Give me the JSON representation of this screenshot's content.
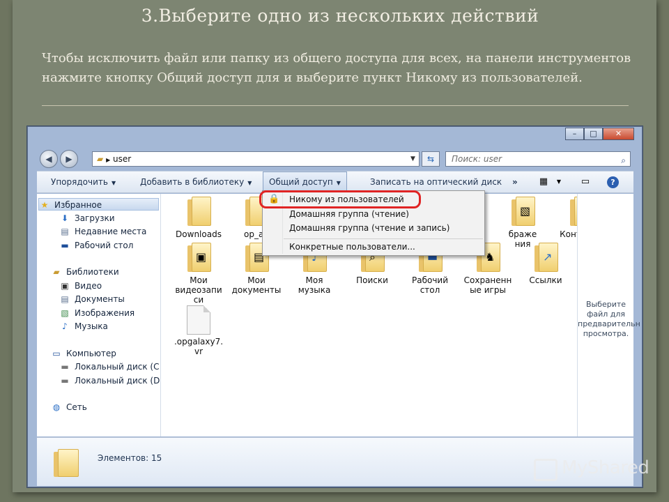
{
  "slide": {
    "title": "3.Выберите одно из нескольких действий",
    "text": "Чтобы исключить файл или папку из общего доступа для всех, на панели инструментов нажмите кнопку Общий доступ для и выберите пункт Никому из пользователей."
  },
  "window": {
    "address": "user",
    "search_placeholder": "Поиск: user",
    "controls": {
      "minimize": "–",
      "maximize": "□",
      "close": "✕"
    }
  },
  "toolbar": {
    "organize": "Упорядочить",
    "add_library": "Добавить в библиотеку",
    "share": "Общий доступ",
    "burn": "Записать на оптический диск",
    "more": "»"
  },
  "nav": {
    "favorites": "Избранное",
    "downloads": "Загрузки",
    "recent": "Недавние места",
    "desktop": "Рабочий стол",
    "libraries": "Библиотеки",
    "video": "Видео",
    "documents": "Документы",
    "images": "Изображения",
    "music": "Музыка",
    "computer": "Компьютер",
    "disk_c": "Локальный диск (C",
    "disk_d": "Локальный диск (D",
    "network": "Сеть"
  },
  "folders": {
    "downloads": "Downloads",
    "op_ad": "op_ad",
    "images_partial": "браже\nния",
    "contacts": "Контакты",
    "my_videos": "Мои\nвидеозапи\nси",
    "my_documents": "Мои\nдокументы",
    "my_music": "Моя\nмузыка",
    "searches": "Поиски",
    "desktop": "Рабочий\nстол",
    "saved_games": "Сохраненн\nые игры",
    "links": "Ссылки",
    "file": ".opgalaxy7.\nvr"
  },
  "preview": {
    "text": "Выберите\nфайл для\nпредварительн\nпросмотра."
  },
  "status": {
    "count": "Элементов: 15"
  },
  "dropdown": {
    "nobody": "Никому из пользователей",
    "homegroup_read": "Домашняя группа (чтение)",
    "homegroup_rw": "Домашняя группа (чтение и запись)",
    "specific": "Конкретные пользователи..."
  },
  "watermark": {
    "text": "MyShared"
  },
  "colors": {
    "accent_highlight": "#e02424",
    "folder": "#f0cf6f",
    "slide_bg": "#7d8572"
  }
}
